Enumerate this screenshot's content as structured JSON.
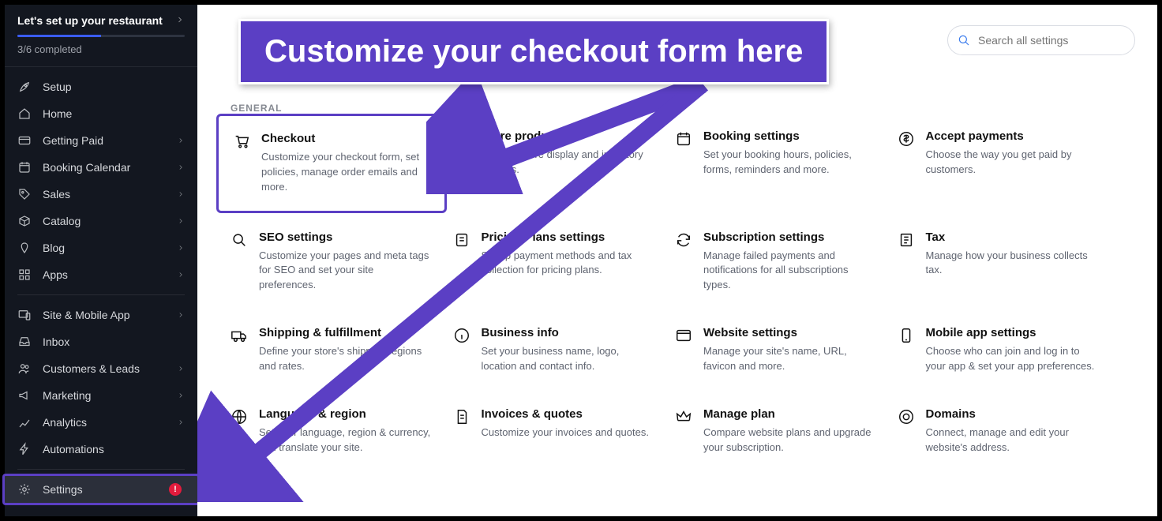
{
  "annotation": {
    "text": "Customize your checkout form here"
  },
  "setup": {
    "title": "Let's set up your restaurant",
    "completed": "3/6 completed"
  },
  "sidebar": {
    "items": [
      {
        "label": "Setup",
        "icon": "rocket",
        "expandable": false
      },
      {
        "label": "Home",
        "icon": "home",
        "expandable": false
      },
      {
        "label": "Getting Paid",
        "icon": "card",
        "expandable": true
      },
      {
        "label": "Booking Calendar",
        "icon": "calendar",
        "expandable": true
      },
      {
        "label": "Sales",
        "icon": "tag",
        "expandable": true
      },
      {
        "label": "Catalog",
        "icon": "box",
        "expandable": true
      },
      {
        "label": "Blog",
        "icon": "pen",
        "expandable": true
      },
      {
        "label": "Apps",
        "icon": "grid",
        "expandable": true
      },
      {
        "label": "Site & Mobile App",
        "icon": "device",
        "expandable": true
      },
      {
        "label": "Inbox",
        "icon": "inbox",
        "expandable": false
      },
      {
        "label": "Customers & Leads",
        "icon": "people",
        "expandable": true
      },
      {
        "label": "Marketing",
        "icon": "megaphone",
        "expandable": true
      },
      {
        "label": "Analytics",
        "icon": "chart",
        "expandable": true
      },
      {
        "label": "Automations",
        "icon": "bolt",
        "expandable": false
      },
      {
        "label": "Settings",
        "icon": "gear",
        "expandable": false,
        "active": true,
        "badge": "!"
      }
    ]
  },
  "search": {
    "placeholder": "Search all settings"
  },
  "section": {
    "label": "GENERAL"
  },
  "cards": [
    {
      "title": "Checkout",
      "desc": "Customize your checkout form, set policies, manage order emails and more.",
      "highlighted": true
    },
    {
      "title": "Store products",
      "desc": "Manage store display and inventory settings."
    },
    {
      "title": "Booking settings",
      "desc": "Set your booking hours, policies, forms, reminders and more."
    },
    {
      "title": "Accept payments",
      "desc": "Choose the way you get paid by customers."
    },
    {
      "title": "SEO settings",
      "desc": "Customize your pages and meta tags for SEO and set your site preferences."
    },
    {
      "title": "Pricing Plans settings",
      "desc": "Set up payment methods and tax collection for pricing plans."
    },
    {
      "title": "Subscription settings",
      "desc": "Manage failed payments and notifications for all subscriptions types."
    },
    {
      "title": "Tax",
      "desc": "Manage how your business collects tax."
    },
    {
      "title": "Shipping & fulfillment",
      "desc": "Define your store's shipping regions and rates."
    },
    {
      "title": "Business info",
      "desc": "Set your business name, logo, location and contact info."
    },
    {
      "title": "Website settings",
      "desc": "Manage your site's name, URL, favicon and more."
    },
    {
      "title": "Mobile app settings",
      "desc": "Choose who can join and log in to your app & set your app preferences."
    },
    {
      "title": "Language & region",
      "desc": "Set your language, region & currency, and translate your site."
    },
    {
      "title": "Invoices & quotes",
      "desc": "Customize your invoices and quotes."
    },
    {
      "title": "Manage plan",
      "desc": "Compare website plans and upgrade your subscription."
    },
    {
      "title": "Domains",
      "desc": "Connect, manage and edit your website's address."
    }
  ]
}
